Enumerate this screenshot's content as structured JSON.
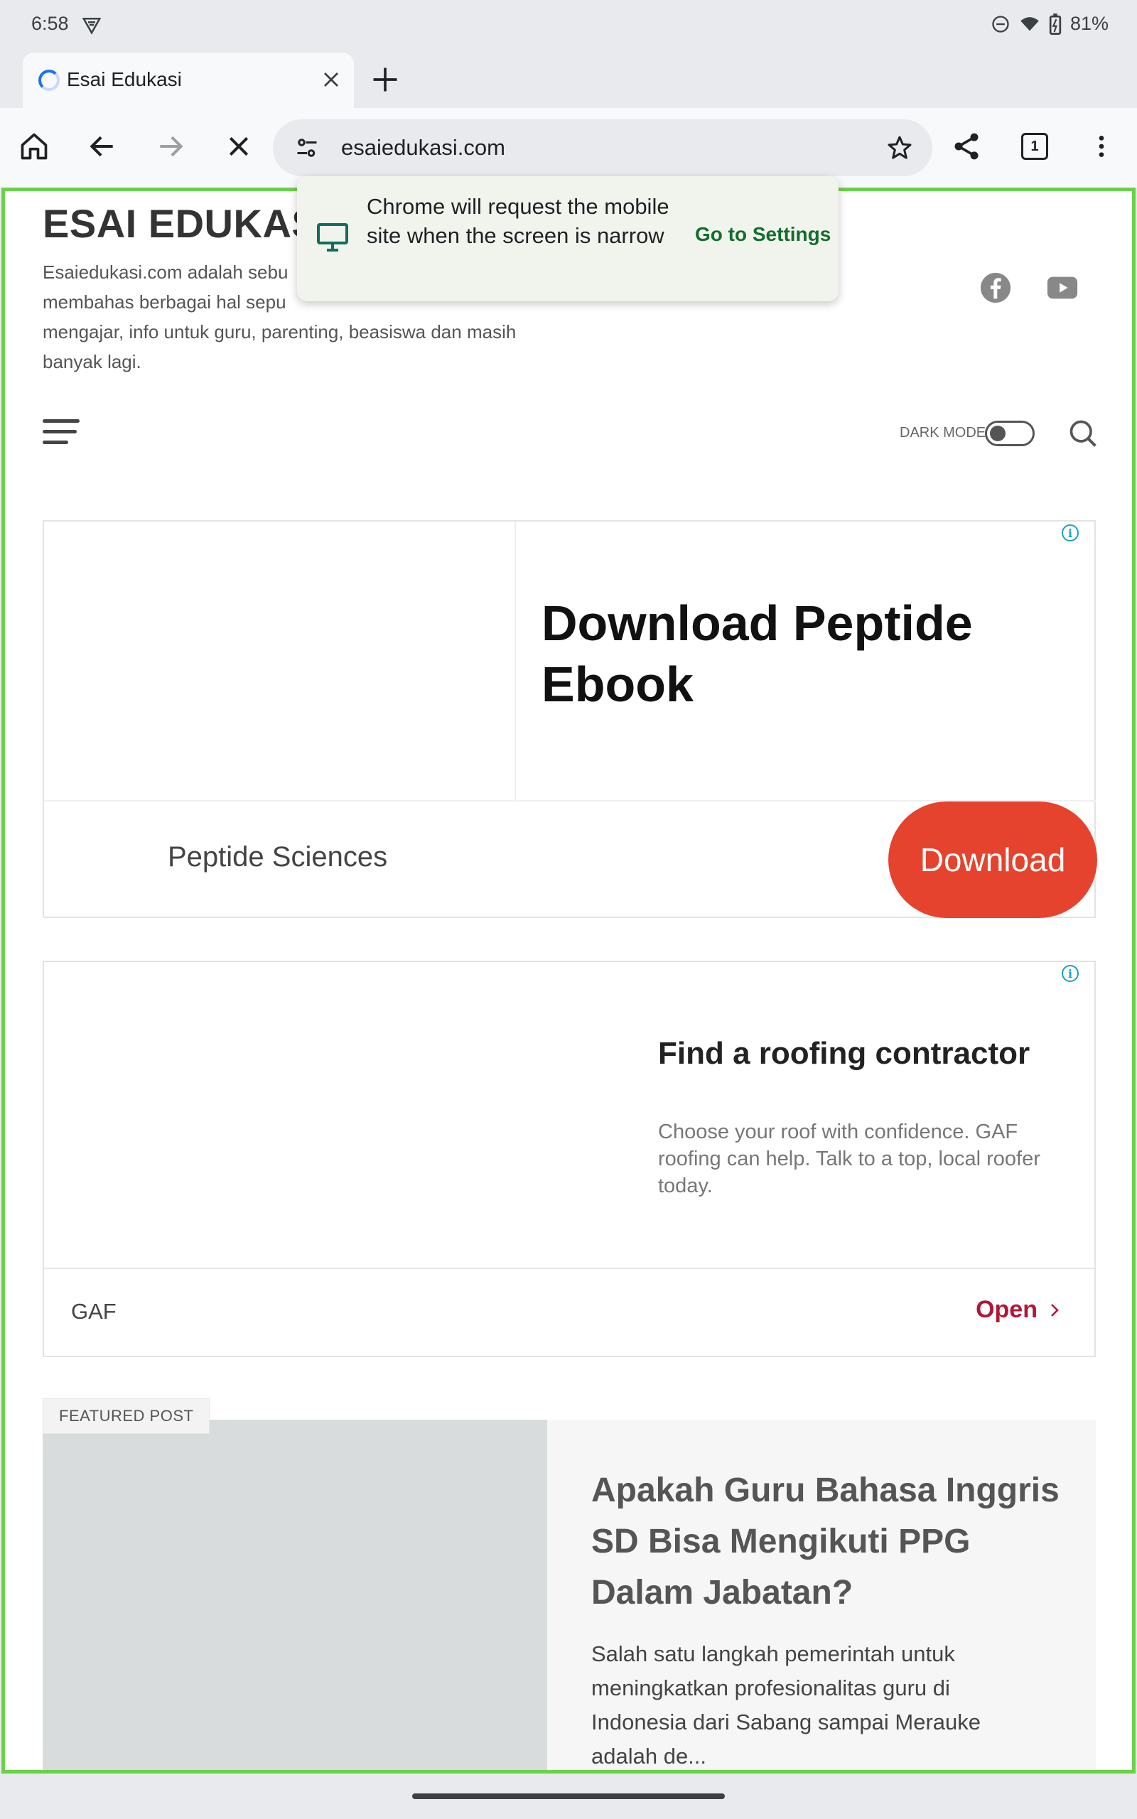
{
  "status_bar": {
    "time": "6:58",
    "battery": "81%"
  },
  "tab": {
    "title": "Esai Edukasi"
  },
  "toolbar": {
    "url": "esaiedukasi.com",
    "tab_count": "1"
  },
  "site": {
    "title": "ESAI EDUKASI",
    "description_line1": "Esaiedukasi.com adalah sebu",
    "description_line2": "membahas berbagai hal sepu",
    "description_line3": "mengajar, info untuk guru, parenting, beasiswa dan masih",
    "description_line4": "banyak lagi.",
    "dark_mode_label": "DARK MODE"
  },
  "toast": {
    "message": "Chrome will request the mobile site when the screen is narrow",
    "action": "Go to Settings"
  },
  "ad1": {
    "headline": "Download Peptide Ebook",
    "advertiser": "Peptide Sciences",
    "cta": "Download",
    "info_glyph": "i"
  },
  "ad2": {
    "headline": "Find a roofing contractor",
    "body": "Choose your roof with confidence. GAF roofing can help. Talk to a top, local roofer today.",
    "advertiser": "GAF",
    "cta": "Open",
    "info_glyph": "i"
  },
  "featured": {
    "badge": "FEATURED POST",
    "title": "Apakah Guru Bahasa Inggris SD Bisa Mengikuti PPG Dalam Jabatan?",
    "excerpt": "Salah satu langkah pemerintah untuk meningkatkan profesionalitas guru di Indonesia dari Sabang sampai Merauke adalah de..."
  },
  "colors": {
    "accent_frame": "#6ad24a",
    "ad_cta": "#e5432d",
    "open_link": "#b01837",
    "toast_action": "#146c2e"
  },
  "icons": [
    "home-icon",
    "back-icon",
    "forward-icon",
    "stop-icon",
    "tune-icon",
    "star-icon",
    "share-icon",
    "menu-icon",
    "facebook-icon",
    "youtube-icon",
    "search-icon",
    "desktop-icon"
  ]
}
